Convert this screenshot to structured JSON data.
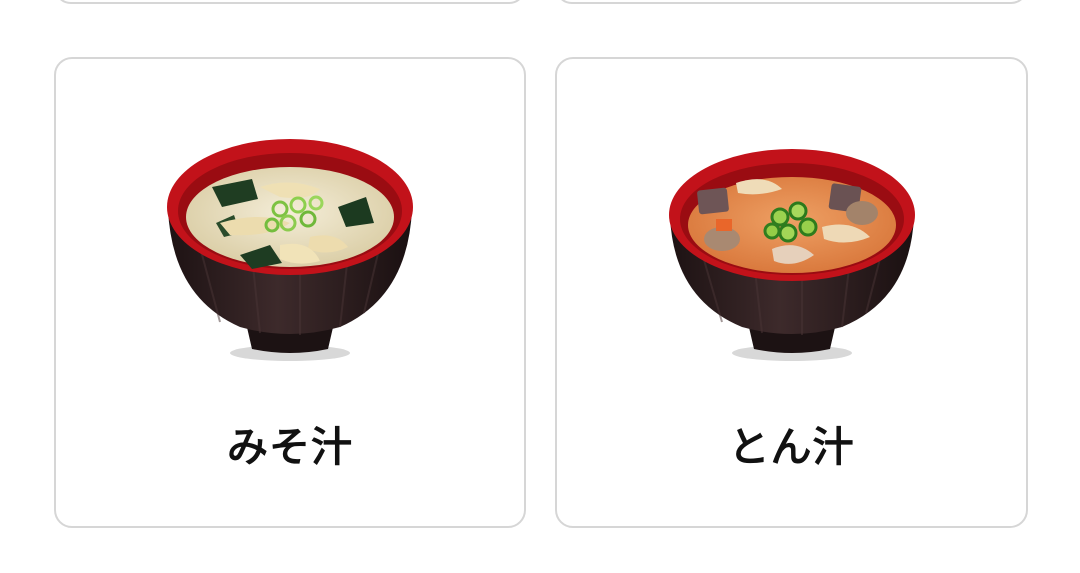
{
  "menu": {
    "items": [
      {
        "id": "miso",
        "label": "みそ汁",
        "image": "miso-soup-bowl"
      },
      {
        "id": "tonjiru",
        "label": "とん汁",
        "image": "tonjiru-soup-bowl"
      }
    ]
  },
  "colors": {
    "card_border": "#d6d6d6",
    "label_text": "#111111",
    "bowl_rim": "#c2121a",
    "bowl_body": "#2a1b1c",
    "miso_broth": "#e9dfc4",
    "tonjiru_broth": "#e0894a",
    "green_onion": "#6fb83a"
  }
}
